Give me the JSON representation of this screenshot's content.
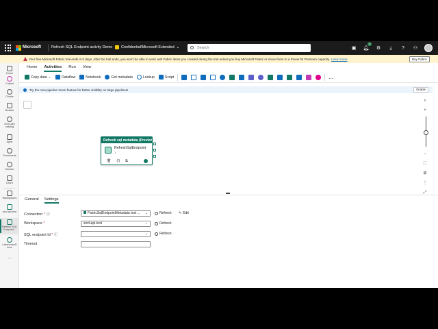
{
  "topbar": {
    "brand": "Microsoft",
    "workspace_title": "Refresh SQL Endpoint activity Demo",
    "sensitivity": "Confidential\\Microsoft Extended",
    "search_placeholder": "Search",
    "notification_count": "17"
  },
  "trial_banner": {
    "text": "Your free Microsoft Fabric trial ends in 0 days. After the trial ends, you won't be able to work with Fabric items you created during the trial unless you buy Microsoft Fabric or move them to a Power BI Premium capacity.",
    "learn_more": "Learn more",
    "buy_button": "Buy Fabric"
  },
  "rail": {
    "items": [
      {
        "label": "Home"
      },
      {
        "label": "Copilot"
      },
      {
        "label": "Create"
      },
      {
        "label": "Browse"
      },
      {
        "label": "OneLake catalog"
      },
      {
        "label": "Apps"
      },
      {
        "label": "Scorecards"
      },
      {
        "label": "Monitor"
      },
      {
        "label": "Learn"
      },
      {
        "label": "Workspaces"
      },
      {
        "label": "sicd-api-test"
      },
      {
        "label": "Refresh SQL Endpoint..."
      },
      {
        "label": "LakehouseD emo"
      }
    ],
    "more": "..."
  },
  "menu_tabs": [
    "Home",
    "Activities",
    "Run",
    "View"
  ],
  "ribbon": {
    "copy_data": "Copy data",
    "dataflow": "Dataflow",
    "notebook": "Notebook",
    "get_metadata": "Get metadata",
    "lookup": "Lookup",
    "script": "Script",
    "more": "..."
  },
  "info_bar": {
    "text": "Try the new pipeline zoom feature for better visibility on large pipelines!",
    "enable": "Enable"
  },
  "activity": {
    "header": "Refresh sql metadata (Preview)",
    "name": "RefreshSqlEndpoint",
    "sub": "1"
  },
  "panel": {
    "tabs": [
      "General",
      "Settings"
    ],
    "connection_label": "Connection",
    "connection_value": "FabricSqlEndpointMetadata test ...",
    "workspace_label": "Workspace",
    "workspace_value": "sicd-api-test",
    "sql_endpoint_label": "SQL endpoint Id",
    "sql_endpoint_value": "",
    "timeout_label": "Timeout",
    "timeout_value": "",
    "refresh": "Refresh",
    "edit": "Edit",
    "required_mark": "*"
  },
  "colors": {
    "accent": "#117865",
    "topbar": "#1b1b1b",
    "banner": "#fff4ce",
    "info": "#ebf3fc"
  }
}
